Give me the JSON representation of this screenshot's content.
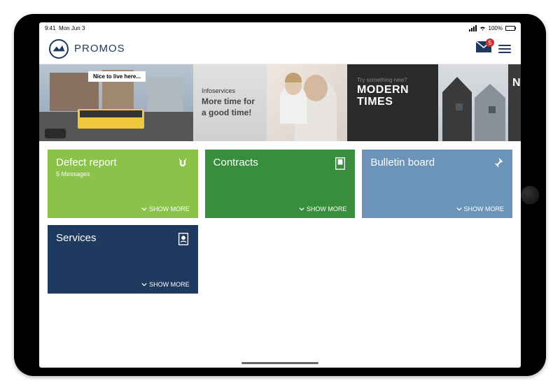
{
  "status": {
    "time": "9:41",
    "date": "Mon Jun 3",
    "battery": "100%"
  },
  "brand": {
    "name": "PROMOS"
  },
  "mail": {
    "badge": "5"
  },
  "carousel": {
    "nice_tag": "Nice to live here...",
    "info_label": "Infoservices",
    "info_title_1": "More time for",
    "info_title_2": "a good time!",
    "modern_sub": "Try something new?",
    "modern_title_1": "MODERN",
    "modern_title_2": "TIMES",
    "next_letter": "N"
  },
  "tiles": {
    "defect": {
      "title": "Defect report",
      "sub": "5 Messages",
      "more": "SHOW MORE"
    },
    "contracts": {
      "title": "Contracts",
      "more": "SHOW MORE"
    },
    "bulletin": {
      "title": "Bulletin board",
      "more": "SHOW MORE"
    },
    "services": {
      "title": "Services",
      "more": "SHOW MORE"
    }
  }
}
